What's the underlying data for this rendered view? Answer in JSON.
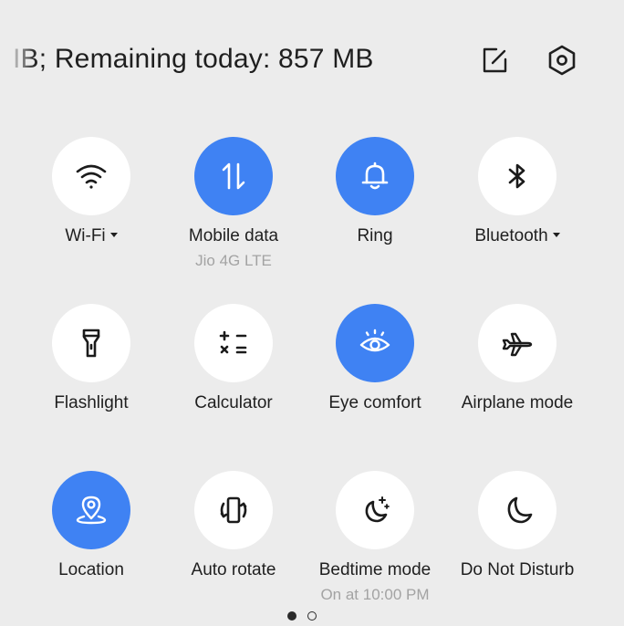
{
  "header": {
    "data_usage_text": "IB; Remaining today: 857 MB"
  },
  "tiles": [
    {
      "label": "Wi-Fi",
      "sub": "",
      "active": false,
      "has_menu": true,
      "icon": "wifi-icon"
    },
    {
      "label": "Mobile data",
      "sub": "Jio 4G LTE",
      "active": true,
      "has_menu": false,
      "icon": "mobile-data-icon"
    },
    {
      "label": "Ring",
      "sub": "",
      "active": true,
      "has_menu": false,
      "icon": "bell-icon"
    },
    {
      "label": "Bluetooth",
      "sub": "",
      "active": false,
      "has_menu": true,
      "icon": "bluetooth-icon"
    },
    {
      "label": "Flashlight",
      "sub": "",
      "active": false,
      "has_menu": false,
      "icon": "flashlight-icon"
    },
    {
      "label": "Calculator",
      "sub": "",
      "active": false,
      "has_menu": false,
      "icon": "calculator-icon"
    },
    {
      "label": "Eye comfort",
      "sub": "",
      "active": true,
      "has_menu": false,
      "icon": "eye-icon"
    },
    {
      "label": "Airplane mode",
      "sub": "",
      "active": false,
      "has_menu": false,
      "icon": "airplane-icon"
    },
    {
      "label": "Location",
      "sub": "",
      "active": true,
      "has_menu": false,
      "icon": "location-pin-icon"
    },
    {
      "label": "Auto rotate",
      "sub": "",
      "active": false,
      "has_menu": false,
      "icon": "auto-rotate-icon"
    },
    {
      "label": "Bedtime mode",
      "sub": "On at 10:00 PM",
      "active": false,
      "has_menu": false,
      "icon": "moon-stars-icon"
    },
    {
      "label": "Do Not Disturb",
      "sub": "",
      "active": false,
      "has_menu": false,
      "icon": "moon-icon"
    }
  ],
  "pager": {
    "total": 2,
    "current": 1
  },
  "colors": {
    "accent": "#3f82f3",
    "background": "#ececec",
    "tile_off": "#ffffff",
    "subtext": "#a3a3a3"
  }
}
